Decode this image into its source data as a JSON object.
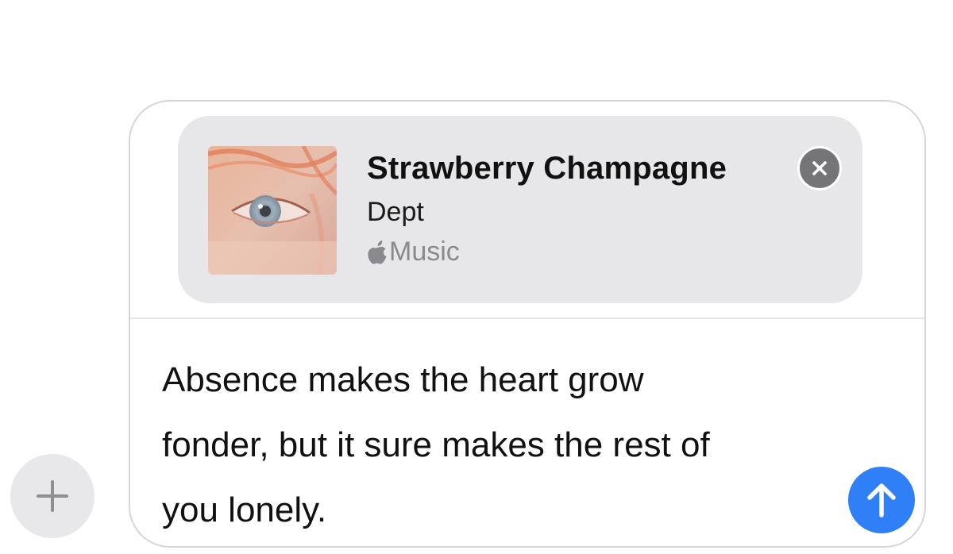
{
  "composer": {
    "attachment": {
      "title": "Strawberry Champagne",
      "artist": "Dept",
      "source": "Music",
      "source_icon": "apple-logo-icon",
      "remove_icon": "close-icon"
    },
    "message": "Absence makes the heart grow\nfonder, but it sure makes the rest of\nyou lonely.",
    "send_icon": "arrow-up-icon",
    "apps_icon": "plus-icon"
  },
  "colors": {
    "send_button": "#2f7ff6",
    "card_background": "#e7e7e9",
    "secondary_text": "#8a8a8e"
  }
}
